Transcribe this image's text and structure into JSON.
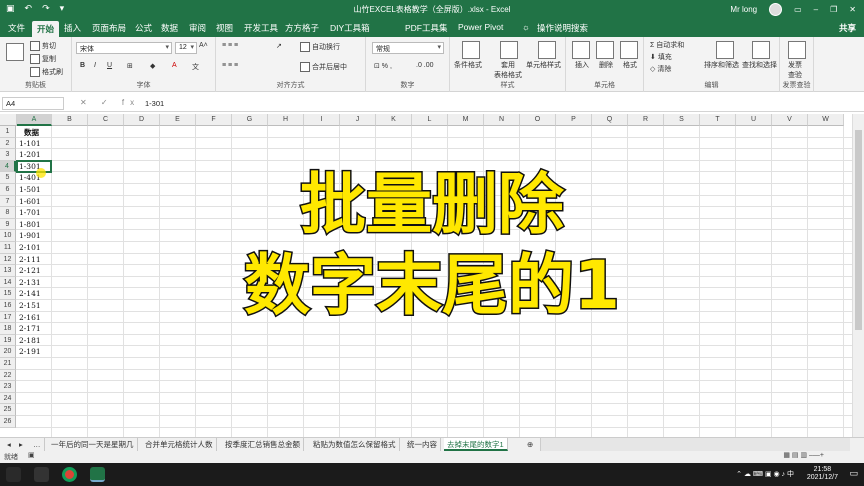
{
  "window": {
    "title": "山竹EXCEL表格教学（全屏版）.xlsx - Excel",
    "user": "Mr long"
  },
  "ribbon_tabs": [
    "文件",
    "开始",
    "插入",
    "页面布局",
    "公式",
    "数据",
    "审阅",
    "视图",
    "开发工具",
    "方方格子",
    "DIY工具箱",
    "PDF工具集",
    "Power Pivot",
    "操作说明搜索"
  ],
  "share_label": "共享",
  "ribbon": {
    "clipboard": {
      "cut": "剪切",
      "copy": "复制",
      "painter": "格式刷",
      "label": "剪贴板"
    },
    "font": {
      "name": "宋体",
      "size": "12",
      "label": "字体"
    },
    "alignment": {
      "wrap": "自动换行",
      "merge": "合并后居中",
      "label": "对齐方式"
    },
    "number": {
      "format": "常规",
      "label": "数字"
    },
    "styles": {
      "conditional": "条件格式",
      "table": "套用\n表格格式",
      "cell": "单元格样式",
      "label": "样式"
    },
    "cells": {
      "insert": "插入",
      "delete": "删除",
      "format": "格式",
      "label": "单元格"
    },
    "editing": {
      "autosum": "自动求和",
      "fill": "填充",
      "clear": "清除",
      "sort": "排序和筛选",
      "find": "查找和选择",
      "label": "编辑"
    },
    "invoice": {
      "btn": "发票\n查验",
      "label": "发票查验"
    }
  },
  "formula_bar": {
    "name_box": "A4",
    "fx": "✕ ✓ fx",
    "value": "1-301"
  },
  "columns": [
    "A",
    "B",
    "C",
    "D",
    "E",
    "F",
    "G",
    "H",
    "I",
    "J",
    "K",
    "L",
    "M",
    "N",
    "O",
    "P",
    "Q",
    "R",
    "S",
    "T",
    "U",
    "V",
    "W"
  ],
  "rows": [
    "1",
    "2",
    "3",
    "4",
    "5",
    "6",
    "7",
    "8",
    "9",
    "10",
    "11",
    "12",
    "13",
    "14",
    "15",
    "16",
    "17",
    "18",
    "19",
    "20",
    "21",
    "22",
    "23",
    "24",
    "25",
    "26"
  ],
  "cells_a": [
    "数据",
    "1-101",
    "1-201",
    "1-301",
    "1-401",
    "1-501",
    "1-601",
    "1-701",
    "1-801",
    "1-901",
    "2-101",
    "2-111",
    "2-121",
    "2-131",
    "2-141",
    "2-151",
    "2-161",
    "2-171",
    "2-181",
    "2-191"
  ],
  "overlay": {
    "line1": "批量删除",
    "line2": "数字末尾的1"
  },
  "sheet_tabs": [
    "一年后的同一天是星期几",
    "合并单元格统计人数",
    "按季度汇总销售总金额",
    "粘贴为数值怎么保留格式",
    "统一内容",
    "去掉末尾的数字1"
  ],
  "status": {
    "ready": "就绪"
  },
  "clock": {
    "time": "21:58",
    "date": "2021/12/7"
  }
}
